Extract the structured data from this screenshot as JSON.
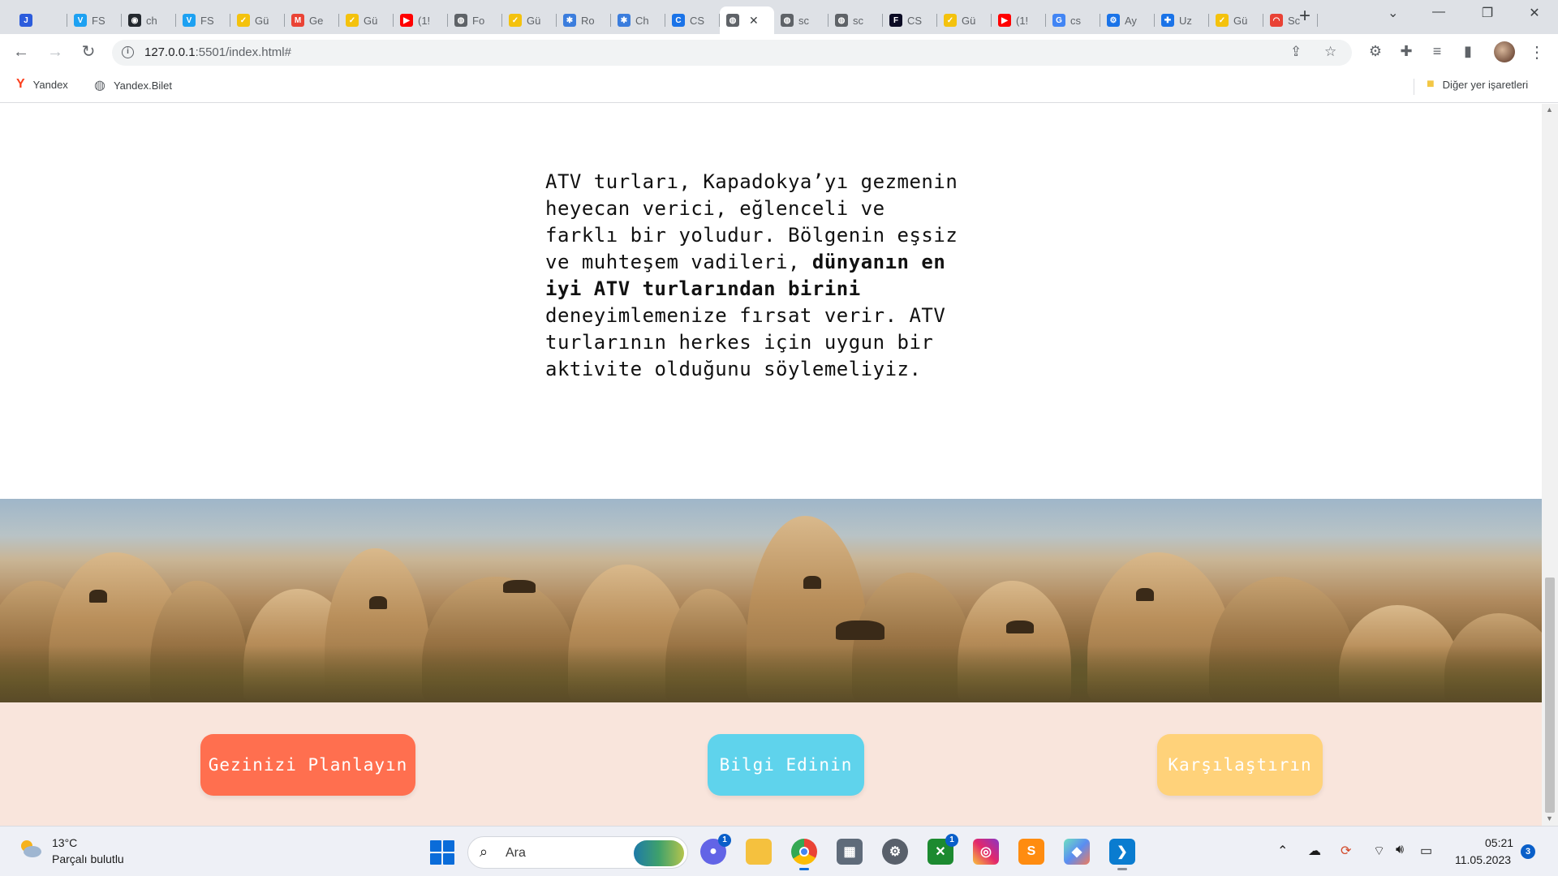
{
  "browser": {
    "tabs": [
      {
        "title": "",
        "icon": "jira-icon",
        "color": "#2c5cdc"
      },
      {
        "title": "FS",
        "icon": "v-icon",
        "color": "#1da1f2"
      },
      {
        "title": "ch",
        "icon": "github-icon",
        "color": "#24292f"
      },
      {
        "title": "FS",
        "icon": "v-icon",
        "color": "#1da1f2"
      },
      {
        "title": "Gü",
        "icon": "check-icon",
        "color": "#f4c20d"
      },
      {
        "title": "Ge",
        "icon": "gmail-icon",
        "color": "#ea4335"
      },
      {
        "title": "Gü",
        "icon": "check-icon",
        "color": "#f4c20d"
      },
      {
        "title": "(1!",
        "icon": "youtube-icon",
        "color": "#ff0000"
      },
      {
        "title": "Fo",
        "icon": "globe-icon",
        "color": "#5f6368"
      },
      {
        "title": "Gü",
        "icon": "check-icon",
        "color": "#f4c20d"
      },
      {
        "title": "Ro",
        "icon": "puzzle-color-icon",
        "color": "#3b7ddd"
      },
      {
        "title": "Ch",
        "icon": "puzzle-color-icon",
        "color": "#3b7ddd"
      },
      {
        "title": "CS",
        "icon": "c-icon",
        "color": "#1a73e8"
      },
      {
        "title": "",
        "icon": "globe-icon",
        "color": "#5f6368",
        "active": true
      },
      {
        "title": "sc",
        "icon": "globe-icon",
        "color": "#5f6368"
      },
      {
        "title": "sc",
        "icon": "globe-icon",
        "color": "#5f6368"
      },
      {
        "title": "CS",
        "icon": "fcc-icon",
        "color": "#0a0a23"
      },
      {
        "title": "Gü",
        "icon": "check-icon",
        "color": "#f4c20d"
      },
      {
        "title": "(1!",
        "icon": "youtube-icon",
        "color": "#ff0000"
      },
      {
        "title": "cs",
        "icon": "google-icon",
        "color": "#4285f4"
      },
      {
        "title": "Ay",
        "icon": "gear-icon",
        "color": "#1a73e8"
      },
      {
        "title": "Uz",
        "icon": "puzzle-icon",
        "color": "#1a73e8"
      },
      {
        "title": "Gü",
        "icon": "check-icon",
        "color": "#f4c20d"
      },
      {
        "title": "Sc",
        "icon": "rainbow-icon",
        "color": "#e94235"
      }
    ],
    "url_host": "127.0.0.1",
    "url_rest": ":5501/index.html#",
    "bookmarks": [
      {
        "label": "Yandex",
        "icon": "yandex-icon"
      },
      {
        "label": "Yandex.Bilet",
        "icon": "globe-icon"
      }
    ],
    "other_bookmarks": "Diğer yer işaretleri"
  },
  "page": {
    "intro_before": "ATV turları, Kapadokya’yı gezmenin heyecan verici, eğlenceli ve farklı bir yoludur. Bölgenin eşsiz ve muhteşem vadileri, ",
    "intro_bold": "dünyanın en iyi ATV turlarından birini",
    "intro_after": " deneyimlemenize fırsat verir. ATV turlarının herkes için uygun bir aktivite olduğunu söylemeliyiz.",
    "cta_plan": "Gezinizi Planlayın",
    "cta_info": "Bilgi Edinin",
    "cta_compare": "Karşılaştırın",
    "colors": {
      "plan": "#ff6f4f",
      "info": "#5fd3ec",
      "compare": "#ffd27a",
      "band": "#f9e5dc"
    }
  },
  "taskbar": {
    "weather_temp": "13°C",
    "weather_desc": "Parçalı bulutlu",
    "search_placeholder": "Ara",
    "apps": [
      {
        "name": "teams-chat-icon",
        "badge": "1"
      },
      {
        "name": "file-explorer-icon"
      },
      {
        "name": "chrome-icon"
      },
      {
        "name": "calculator-icon"
      },
      {
        "name": "settings-icon"
      },
      {
        "name": "xbox-icon",
        "badge": "1"
      },
      {
        "name": "instagram-icon"
      },
      {
        "name": "sublime-text-icon"
      },
      {
        "name": "gitkraken-icon"
      },
      {
        "name": "vscode-icon"
      }
    ],
    "time": "05:21",
    "date": "11.05.2023",
    "notifications": "3"
  }
}
